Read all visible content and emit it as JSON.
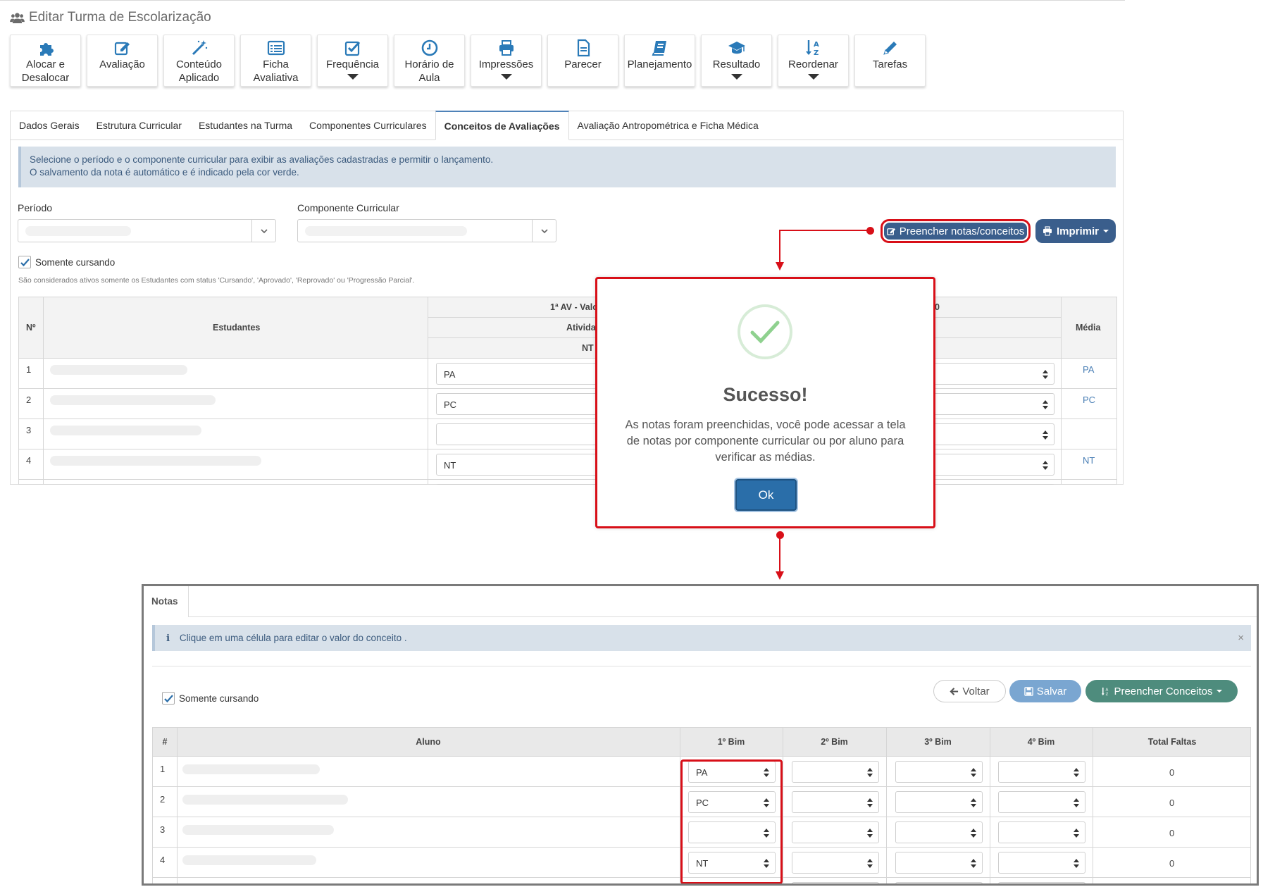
{
  "top": {
    "title": "Editar Turma de Escolarização",
    "toolbar": [
      {
        "label1": "Alocar e",
        "label2": "Desalocar",
        "icon": "puzzle-icon"
      },
      {
        "label1": "Avaliação",
        "label2": "",
        "icon": "edit-icon"
      },
      {
        "label1": "Conteúdo",
        "label2": "Aplicado",
        "icon": "magic-wand-icon"
      },
      {
        "label1": "Ficha",
        "label2": "Avaliativa",
        "icon": "list-icon"
      },
      {
        "label1": "Frequência",
        "label2": "",
        "icon": "check-square-icon"
      },
      {
        "label1": "Horário de",
        "label2": "Aula",
        "icon": "clock-icon"
      },
      {
        "label1": "Impressões",
        "label2": "",
        "icon": "printer-icon"
      },
      {
        "label1": "Parecer",
        "label2": "",
        "icon": "document-icon"
      },
      {
        "label1": "Planejamento",
        "label2": "",
        "icon": "book-icon"
      },
      {
        "label1": "Resultado",
        "label2": "",
        "icon": "graduation-cap-icon"
      },
      {
        "label1": "Reordenar",
        "label2": "",
        "icon": "sort-alpha-icon"
      },
      {
        "label1": "Tarefas",
        "label2": "",
        "icon": "pencil-icon"
      }
    ],
    "tabs": [
      "Dados Gerais",
      "Estrutura Curricular",
      "Estudantes na Turma",
      "Componentes Curriculares",
      "Conceitos de Avaliações",
      "Avaliação Antropométrica e Ficha Médica"
    ],
    "info_line1": "Selecione o período e o componente curricular para exibir as avaliações cadastradas e permitir o lançamento.",
    "info_line2": "O salvamento da nota é automático e é indicado pela cor verde.",
    "periodo_label": "Período",
    "componente_label": "Componente Curricular",
    "fill_button": "Preencher notas/conceitos",
    "print_button": "Imprimir",
    "somente_cursando": "Somente cursando",
    "note": "São considerados ativos somente os Estudantes com status 'Cursando', 'Aprovado', 'Reprovado' ou 'Progressão Parcial'.",
    "table": {
      "col_num": "Nº",
      "col_students": "Estudantes",
      "col_av": "1ª AV - Valo",
      "col_av_right": "0",
      "col_ativ": "Ativida",
      "col_nt": "NT",
      "col_media": "Média",
      "rows": [
        {
          "num": "1",
          "grade": "PA",
          "media": "PA"
        },
        {
          "num": "2",
          "grade": "PC",
          "media": "PC"
        },
        {
          "num": "3",
          "grade": "",
          "media": ""
        },
        {
          "num": "4",
          "grade": "NT",
          "media": "NT"
        }
      ]
    }
  },
  "modal": {
    "title": "Sucesso!",
    "message": "As notas foram preenchidas, você pode acessar a tela de notas por componente curricular ou por aluno para verificar as médias.",
    "ok": "Ok"
  },
  "bottom": {
    "tab": "Notas",
    "info": "Clique em uma célula para editar o valor do conceito .",
    "somente_cursando": "Somente cursando",
    "voltar": "Voltar",
    "salvar": "Salvar",
    "preencher": "Preencher Conceitos",
    "table": {
      "col_num": "#",
      "col_aluno": "Aluno",
      "bims": [
        "1º Bim",
        "2º Bim",
        "3º Bim",
        "4º Bim"
      ],
      "col_faltas": "Total Faltas",
      "rows": [
        {
          "num": "1",
          "bim1": "PA",
          "faltas": "0"
        },
        {
          "num": "2",
          "bim1": "PC",
          "faltas": "0"
        },
        {
          "num": "3",
          "bim1": "",
          "faltas": "0"
        },
        {
          "num": "4",
          "bim1": "NT",
          "faltas": "0"
        }
      ]
    }
  },
  "colors": {
    "primary_button": "#3a5e8c",
    "highlight_red": "#d80f18",
    "ok_button": "#2a6ea9",
    "success_green": "#8fd18f",
    "preencher_green": "#4e8c7d",
    "salvar_blue": "#7aa6d1"
  }
}
